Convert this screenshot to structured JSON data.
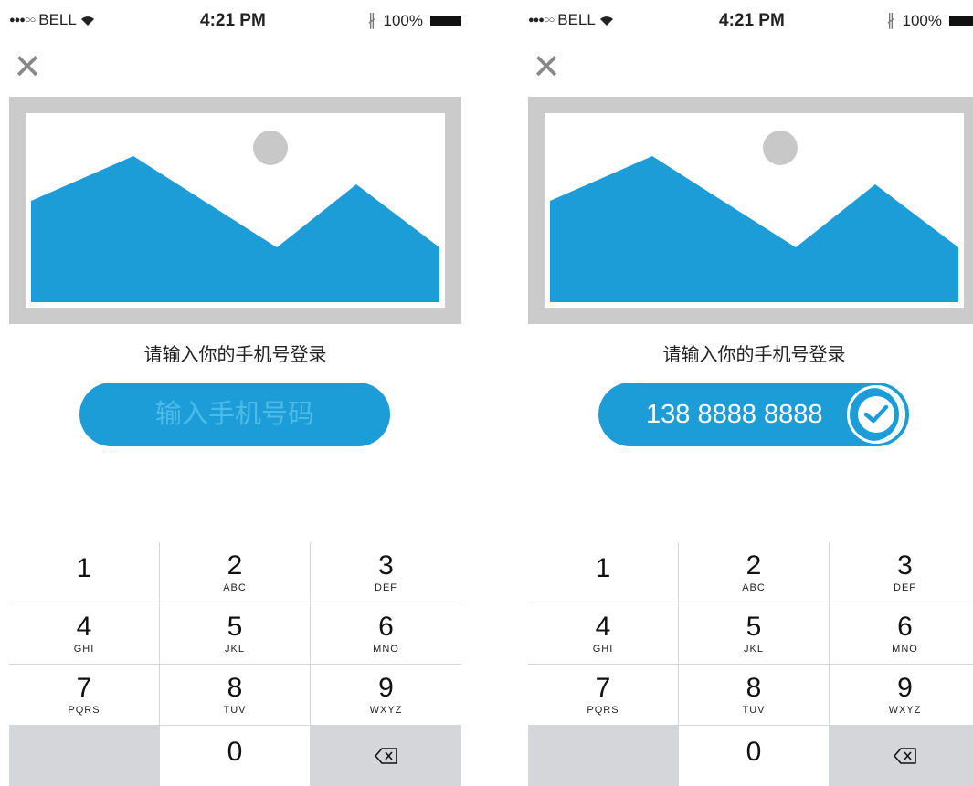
{
  "status_bar": {
    "signal_dots": "●●●○○",
    "carrier": "BELL",
    "wifi_icon": "wifi-icon",
    "time": "4:21 PM",
    "bluetooth_icon": "bluetooth-icon",
    "battery": "100%"
  },
  "colors": {
    "accent": "#1d9dd8",
    "placeholder_bg": "#cbcbcb",
    "sun": "#c8c8c8",
    "keypad_gray": "#d4d6da"
  },
  "close_glyph": "✕",
  "prompt": "请输入你的手机号登录",
  "screens": {
    "left": {
      "input_placeholder": "输入手机号码"
    },
    "right": {
      "input_value": "138 8888 8888"
    }
  },
  "keypad": [
    {
      "num": "1",
      "letters": ""
    },
    {
      "num": "2",
      "letters": "ABC"
    },
    {
      "num": "3",
      "letters": "DEF"
    },
    {
      "num": "4",
      "letters": "GHI"
    },
    {
      "num": "5",
      "letters": "JKL"
    },
    {
      "num": "6",
      "letters": "MNO"
    },
    {
      "num": "7",
      "letters": "PQRS"
    },
    {
      "num": "8",
      "letters": "TUV"
    },
    {
      "num": "9",
      "letters": "WXYZ"
    },
    {
      "num": "",
      "letters": ""
    },
    {
      "num": "0",
      "letters": ""
    },
    {
      "num": "⌫",
      "letters": ""
    }
  ]
}
